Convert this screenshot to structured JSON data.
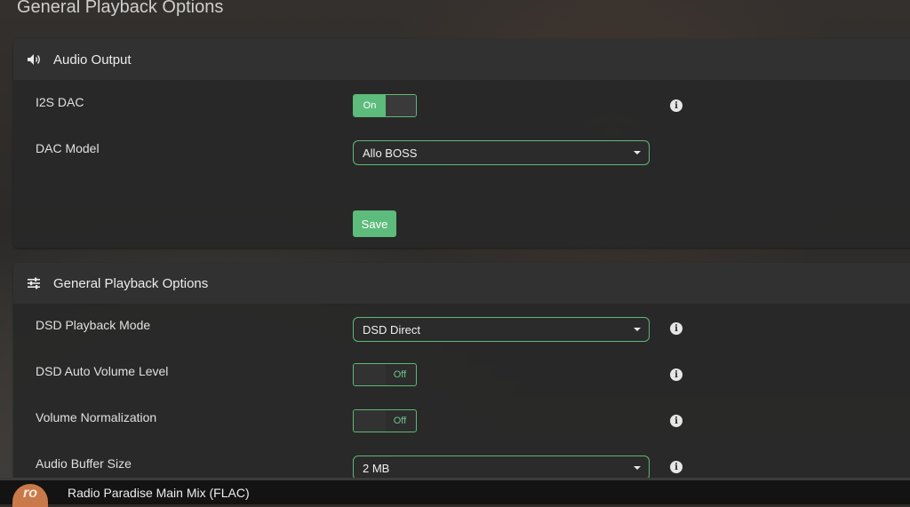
{
  "page": {
    "title": "General Playback Options"
  },
  "audio_output": {
    "title": "Audio Output",
    "icon": "speaker-icon",
    "i2s_dac": {
      "label": "I2S DAC",
      "state": "On"
    },
    "dac_model": {
      "label": "DAC Model",
      "value": "Allo BOSS"
    },
    "save_label": "Save"
  },
  "playback": {
    "title": "General Playback Options",
    "icon": "sliders-icon",
    "dsd_mode": {
      "label": "DSD Playback Mode",
      "value": "DSD Direct"
    },
    "dsd_auto_volume": {
      "label": "DSD Auto Volume Level",
      "state": "Off"
    },
    "volume_normalization": {
      "label": "Volume Normalization",
      "state": "Off"
    },
    "buffer_size": {
      "label": "Audio Buffer Size",
      "value": "2 MB"
    }
  },
  "footer": {
    "logo_text": "ro",
    "now_playing": "Radio Paradise Main Mix (FLAC)"
  },
  "colors": {
    "accent": "#5dbb7c",
    "panel": "#282828"
  }
}
